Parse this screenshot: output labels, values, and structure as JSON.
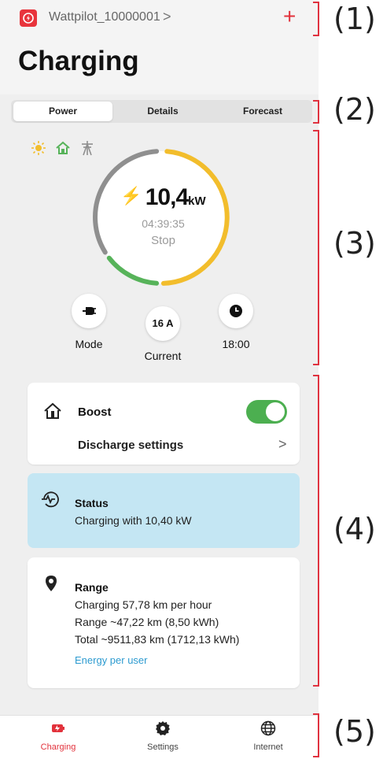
{
  "header": {
    "device_name": "Wattpilot_10000001",
    "device_chevron": ">",
    "add_label": "+",
    "title": "Charging"
  },
  "tabs": [
    {
      "label": "Power",
      "active": true
    },
    {
      "label": "Details",
      "active": false
    },
    {
      "label": "Forecast",
      "active": false
    }
  ],
  "power": {
    "sources": [
      "sun-icon",
      "home-icon",
      "grid-pylon-icon"
    ],
    "value": "10,4",
    "unit": "kW",
    "timer": "04:39:35",
    "stop_label": "Stop",
    "ring_colors": {
      "grid": "#8f8f8f",
      "solar": "#f2bd2c",
      "battery": "#57b35a"
    },
    "mode_label": "Mode",
    "current_value": "16 A",
    "current_label": "Current",
    "time_value": "18:00"
  },
  "boost": {
    "title": "Boost",
    "toggle_on": true,
    "discharge_label": "Discharge settings",
    "discharge_chevron": ">"
  },
  "status": {
    "title": "Status",
    "text": "Charging with 10,40 kW"
  },
  "range": {
    "title": "Range",
    "lines": [
      "Charging 57,78 km per hour",
      "Range ~47,22 km (8,50 kWh)",
      "Total ~9511,83 km (1712,13 kWh)"
    ],
    "link": "Energy per user"
  },
  "nav": [
    {
      "label": "Charging",
      "icon": "car-battery-icon",
      "active": true
    },
    {
      "label": "Settings",
      "icon": "gear-icon",
      "active": false
    },
    {
      "label": "Internet",
      "icon": "globe-icon",
      "active": false
    }
  ],
  "annotations": [
    "(1)",
    "(2)",
    "(3)",
    "(4)",
    "(5)"
  ],
  "colors": {
    "accent": "#e2323c",
    "toggle": "#4caf50",
    "status_bg": "#c4e6f3",
    "link": "#2d9bd0"
  }
}
